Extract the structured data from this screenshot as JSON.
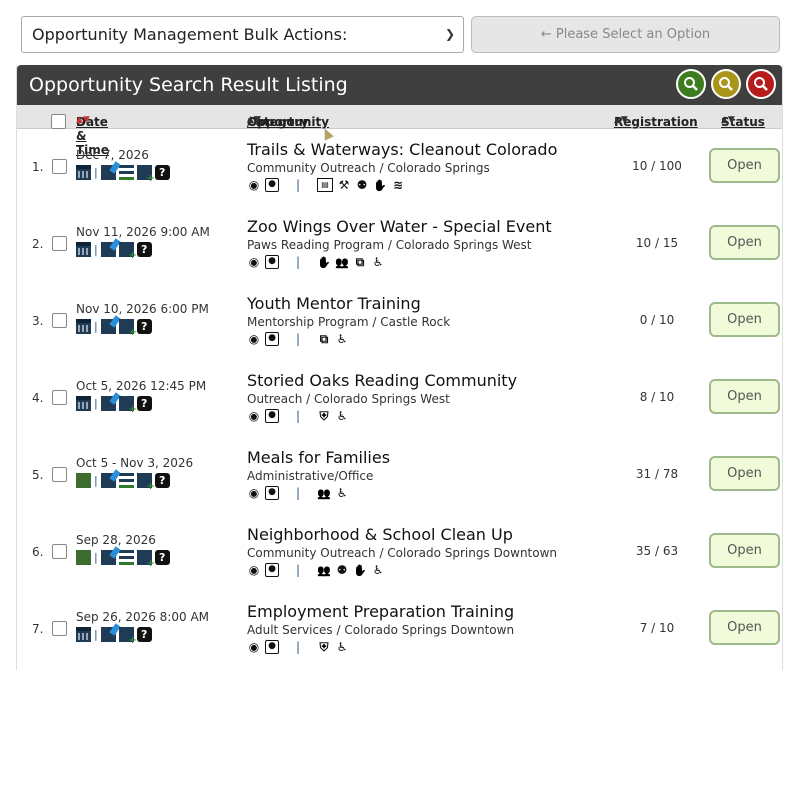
{
  "bulk": {
    "select_value": "Opportunity Management Bulk Actions:",
    "apply_label": "← Please Select an Option"
  },
  "panel": {
    "title": "Opportunity Search Result Listing",
    "icons": [
      {
        "name": "search-green-icon",
        "color": "#3e7d1f"
      },
      {
        "name": "search-gold-icon",
        "color": "#a8951a"
      },
      {
        "name": "search-red-icon",
        "color": "#b71c1c"
      }
    ]
  },
  "columns": {
    "date": "Date & Time",
    "opportunity": "Opportunity",
    "separator": " / ",
    "category": "Category",
    "registration": "Registration",
    "status": "Status"
  },
  "rows": [
    {
      "num": "1.",
      "date": "Dec 7, 2026",
      "title": "Trails & Waterways: Cleanout Colorado",
      "category": "Community Outreach / Colorado Springs",
      "registration": "10 / 100",
      "status": "Open",
      "icons": [
        "eye",
        "person",
        "pipe2",
        "card",
        "gavel",
        "ppl",
        "hands",
        "swim"
      ],
      "date_icons": [
        "cal",
        "pipe",
        "edit",
        "list",
        "add",
        "help"
      ]
    },
    {
      "num": "2.",
      "date": "Nov 11, 2026 9:00 AM",
      "title": "Zoo Wings Over Water - Special Event",
      "category": "Paws Reading Program / Colorado Springs West",
      "registration": "10 / 15",
      "status": "Open",
      "icons": [
        "eye",
        "person",
        "pipe2",
        "hands",
        "group",
        "lang",
        "wheel"
      ],
      "date_icons": [
        "cal",
        "pipe",
        "edit",
        "add",
        "help"
      ]
    },
    {
      "num": "3.",
      "date": "Nov 10, 2026 6:00 PM",
      "title": "Youth Mentor Training",
      "category": "Mentorship Program / Castle Rock",
      "registration": "0 / 10",
      "status": "Open",
      "icons": [
        "eye",
        "person",
        "pipe2",
        "lang",
        "wheel"
      ],
      "date_icons": [
        "cal",
        "pipe",
        "edit",
        "add",
        "help"
      ]
    },
    {
      "num": "4.",
      "date": "Oct 5, 2026 12:45 PM",
      "title": "Storied Oaks Reading Community",
      "category": "Outreach / Colorado Springs West",
      "registration": "8 / 10",
      "status": "Open",
      "icons": [
        "eye",
        "person",
        "pipe2",
        "shield",
        "wheel"
      ],
      "date_icons": [
        "cal",
        "pipe",
        "edit",
        "add",
        "help"
      ]
    },
    {
      "num": "5.",
      "date": "Oct 5 - Nov 3, 2026",
      "title": "Meals for Families",
      "category": "Administrative/Office",
      "registration": "31 / 78",
      "status": "Open",
      "icons": [
        "eye",
        "person",
        "pipe2",
        "group",
        "wheel"
      ],
      "date_icons": [
        "green",
        "pipe",
        "edit",
        "list",
        "add",
        "help"
      ]
    },
    {
      "num": "6.",
      "date": "Sep 28, 2026",
      "title": "Neighborhood & School Clean Up",
      "category": "Community Outreach / Colorado Springs Downtown",
      "registration": "35 / 63",
      "status": "Open",
      "icons": [
        "eye",
        "person",
        "pipe2",
        "group",
        "ppl",
        "hands",
        "wheel"
      ],
      "date_icons": [
        "green",
        "pipe",
        "edit",
        "list",
        "add",
        "help"
      ]
    },
    {
      "num": "7.",
      "date": "Sep 26, 2026 8:00 AM",
      "title": "Employment Preparation Training",
      "category": "Adult Services / Colorado Springs Downtown",
      "registration": "7 / 10",
      "status": "Open",
      "icons": [
        "eye",
        "person",
        "pipe2",
        "shield",
        "wheel"
      ],
      "date_icons": [
        "cal",
        "pipe",
        "edit",
        "add",
        "help"
      ]
    }
  ]
}
